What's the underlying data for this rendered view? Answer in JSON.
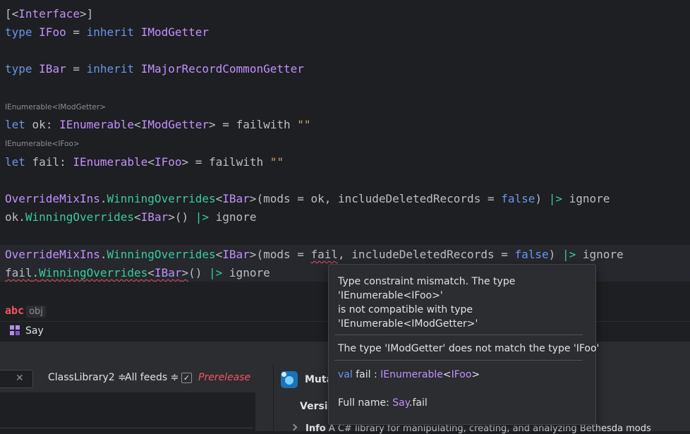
{
  "code": {
    "attr_open": "[<",
    "attr_name": "Interface",
    "attr_close": ">]",
    "kw_type": "type",
    "kw_let": "let",
    "kw_inherit": "inherit",
    "foo_name": "IFoo",
    "bar_name": "IBar",
    "mod_getter": "IModGetter",
    "major_getter": "IMajorRecordCommonGetter",
    "hint_ok": "IEnumerable<IModGetter>",
    "hint_fail": "IEnumerable<IFoo>",
    "ok_var": "ok",
    "fail_var": "fail",
    "ienum": "IEnumerable",
    "lt": "<",
    "gt": ">",
    "eq": " = ",
    "colon": ": ",
    "failwith": "failwith",
    "empty_str": "\"\"",
    "override_cls": "OverrideMixIns",
    "winning": "WinningOverrides",
    "dot": ".",
    "args_open": "(mods = ",
    "comma": ", ",
    "include_del": "includeDeletedRecords",
    "false_kw": "false",
    "close_paren": ")",
    "empty_call": "()",
    "pipe": "|>",
    "ignore": "ignore",
    "abc": "abc",
    "obj": "obj"
  },
  "say_label": "Say",
  "tooltip": {
    "msg_line1": "Type constraint mismatch. The type",
    "msg_line2": "'IEnumerable<IFoo>'",
    "msg_line3": "is not compatible with type",
    "msg_line4": "'IEnumerable<IModGetter>'",
    "detail": "The type 'IModGetter' does not match the type 'IFoo'",
    "sig_kw": "val",
    "sig_name": "fail",
    "sig_colon": " : ",
    "sig_type": "IEnumerable",
    "sig_lt": "<",
    "sig_type_arg": "IFoo",
    "sig_gt": ">",
    "fullname_label": "Full name: ",
    "fullname_ns": "Say",
    "fullname_member": ".fail"
  },
  "nuget": {
    "project_select": "ClassLibrary2 ≑",
    "feed_select": "All feeds ≑",
    "prerelease_label": "Prerelease",
    "package_name": "Muta",
    "version_label": "Versic",
    "desc_prefix": "Info",
    "description": "A C# library for manipulating, creating, and analyzing Bethesda mods"
  },
  "colors": {
    "keyword": "#6c95eb",
    "type": "#c191ff",
    "method": "#39cc9b",
    "string": "#c9a26d",
    "error": "#f75464"
  }
}
